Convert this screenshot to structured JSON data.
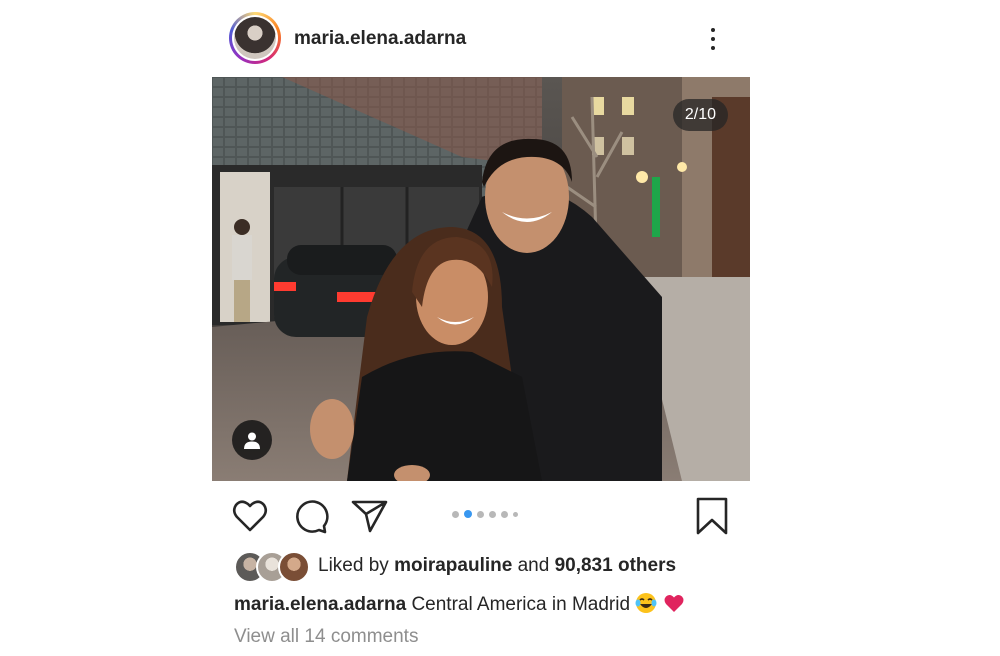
{
  "post": {
    "username": "maria.elena.adarna",
    "carousel_counter": "2/10",
    "carousel": {
      "total_dots": 6,
      "active_index": 1
    },
    "liked_by_prefix": "Liked by",
    "liked_by_user": "moirapauline",
    "liked_by_and": "and",
    "liked_by_others": "90,831 others",
    "caption_username": "maria.elena.adarna",
    "caption_text": "Central America in Madrid",
    "caption_emojis": [
      "face-with-tears-of-joy",
      "red-heart"
    ],
    "view_comments": "View all 14 comments"
  },
  "icons": {
    "more": "more-vertical-icon",
    "tag": "user-tag-icon",
    "like": "heart-icon",
    "comment": "comment-icon",
    "share": "paper-plane-icon",
    "save": "bookmark-icon"
  },
  "colors": {
    "text": "#262626",
    "muted": "#8e8e8e",
    "active_dot": "#3897f0",
    "inactive_dot": "#b8b8b8",
    "heart_emoji": "#e0245e"
  }
}
